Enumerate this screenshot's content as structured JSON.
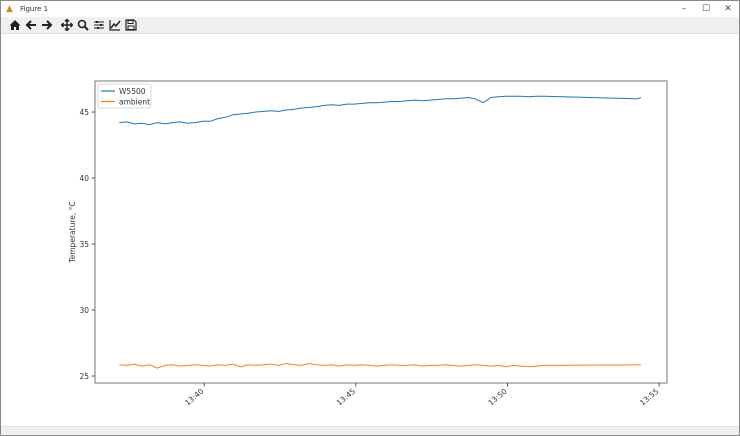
{
  "window": {
    "title": "Figure 1",
    "minimize": "–",
    "maximize": "☐",
    "close": "✕"
  },
  "toolbar": {
    "buttons": [
      "home-icon",
      "back-icon",
      "forward-icon",
      "pan-icon",
      "zoom-icon",
      "configure-subplots-icon",
      "edit-axes-icon",
      "save-icon"
    ]
  },
  "colors": {
    "W5500": "#1f77b4",
    "ambient": "#ff7f0e"
  },
  "chart_data": {
    "type": "line",
    "title": "",
    "xlabel": "",
    "ylabel": "Temperature, °C",
    "x_units": "minutes after 13:00",
    "xlim": [
      36.4,
      55.26
    ],
    "ylim": [
      24.47,
      47.35
    ],
    "xticks": [
      40,
      45,
      50,
      55
    ],
    "xtick_labels": [
      "13:40",
      "13:45",
      "13:50",
      "13:55"
    ],
    "yticks": [
      25,
      30,
      35,
      40,
      45
    ],
    "ytick_labels": [
      "25",
      "30",
      "35",
      "40",
      "45"
    ],
    "legend": {
      "position": "top-left",
      "entries": [
        "W5500",
        "ambient"
      ]
    },
    "series": [
      {
        "name": "W5500",
        "x": [
          37.2,
          37.45,
          37.7,
          37.95,
          38.2,
          38.45,
          38.7,
          38.95,
          39.2,
          39.45,
          39.7,
          39.95,
          40.2,
          40.45,
          40.7,
          40.95,
          41.2,
          41.45,
          41.7,
          41.95,
          42.2,
          42.45,
          42.7,
          42.95,
          43.2,
          43.45,
          43.7,
          43.95,
          44.2,
          44.45,
          44.7,
          44.95,
          45.2,
          45.45,
          45.7,
          45.95,
          46.2,
          46.45,
          46.7,
          46.95,
          47.2,
          47.45,
          47.7,
          47.95,
          48.2,
          48.45,
          48.7,
          48.95,
          49.2,
          49.45,
          49.7,
          49.95,
          50.2,
          50.45,
          50.7,
          50.95,
          51.2,
          54.3,
          54.4
        ],
        "y": [
          44.2,
          44.25,
          44.1,
          44.15,
          44.05,
          44.2,
          44.1,
          44.2,
          44.25,
          44.15,
          44.2,
          44.3,
          44.3,
          44.5,
          44.6,
          44.8,
          44.85,
          44.9,
          45.0,
          45.05,
          45.1,
          45.05,
          45.15,
          45.2,
          45.3,
          45.35,
          45.4,
          45.5,
          45.55,
          45.5,
          45.6,
          45.6,
          45.65,
          45.7,
          45.7,
          45.75,
          45.8,
          45.8,
          45.85,
          45.9,
          45.85,
          45.9,
          45.95,
          46.0,
          46.0,
          46.05,
          46.1,
          46.0,
          45.7,
          46.1,
          46.15,
          46.2,
          46.2,
          46.2,
          46.15,
          46.2,
          46.2,
          46.0,
          46.1
        ]
      },
      {
        "name": "ambient",
        "x": [
          37.2,
          37.45,
          37.7,
          37.95,
          38.2,
          38.45,
          38.7,
          38.95,
          39.2,
          39.45,
          39.7,
          39.95,
          40.2,
          40.45,
          40.7,
          40.95,
          41.2,
          41.45,
          41.7,
          41.95,
          42.2,
          42.45,
          42.7,
          42.95,
          43.2,
          43.45,
          43.7,
          43.95,
          44.2,
          44.45,
          44.7,
          44.95,
          45.2,
          45.45,
          45.7,
          45.95,
          46.2,
          46.45,
          46.7,
          46.95,
          47.2,
          47.45,
          47.7,
          47.95,
          48.2,
          48.45,
          48.7,
          48.95,
          49.2,
          49.45,
          49.7,
          49.95,
          50.2,
          50.45,
          50.7,
          50.95,
          51.2,
          54.4
        ],
        "y": [
          25.85,
          25.8,
          25.9,
          25.75,
          25.85,
          25.6,
          25.8,
          25.85,
          25.75,
          25.8,
          25.85,
          25.8,
          25.75,
          25.85,
          25.8,
          25.9,
          25.7,
          25.85,
          25.8,
          25.85,
          25.9,
          25.8,
          25.95,
          25.85,
          25.8,
          25.95,
          25.85,
          25.8,
          25.85,
          25.75,
          25.85,
          25.8,
          25.85,
          25.8,
          25.75,
          25.8,
          25.85,
          25.8,
          25.8,
          25.85,
          25.75,
          25.8,
          25.8,
          25.85,
          25.8,
          25.75,
          25.8,
          25.85,
          25.8,
          25.75,
          25.8,
          25.7,
          25.8,
          25.75,
          25.7,
          25.75,
          25.8,
          25.85
        ]
      }
    ]
  }
}
